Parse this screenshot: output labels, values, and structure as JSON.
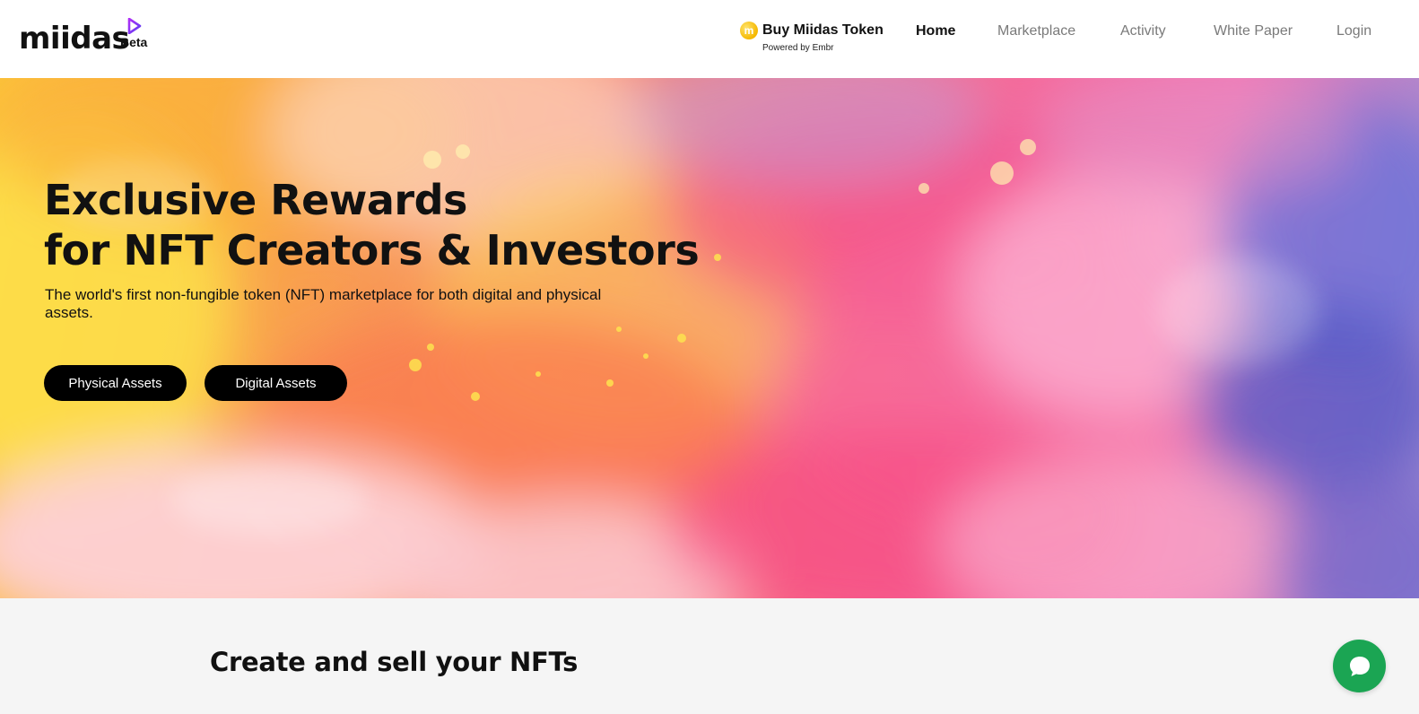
{
  "header": {
    "logo": {
      "wordmark": "miidas",
      "badge": "Beta"
    },
    "buy_token": {
      "label": "Buy Miidas Token",
      "powered_by": "Powered by Embr",
      "icon": "coin-icon",
      "coin_letter": "m"
    },
    "nav": {
      "home": "Home",
      "marketplace": "Marketplace",
      "activity": "Activity",
      "white_paper": "White Paper",
      "login": "Login"
    }
  },
  "hero": {
    "title_line1": "Exclusive Rewards",
    "title_line2": "for NFT Creators & Investors",
    "subtitle": "The world's first non-fungible token (NFT) marketplace for both digital and physical assets.",
    "buttons": {
      "physical": "Physical Assets",
      "digital": "Digital Assets"
    }
  },
  "section": {
    "title": "Create and sell your NFTs"
  },
  "chat": {
    "icon": "chat-bubble-icon"
  },
  "colors": {
    "accent_chat": "#1ba553",
    "button_bg": "#000000",
    "logo_mark": "#7b2ff7",
    "nav_active": "#111111",
    "nav_inactive": "#7a7a7a"
  }
}
